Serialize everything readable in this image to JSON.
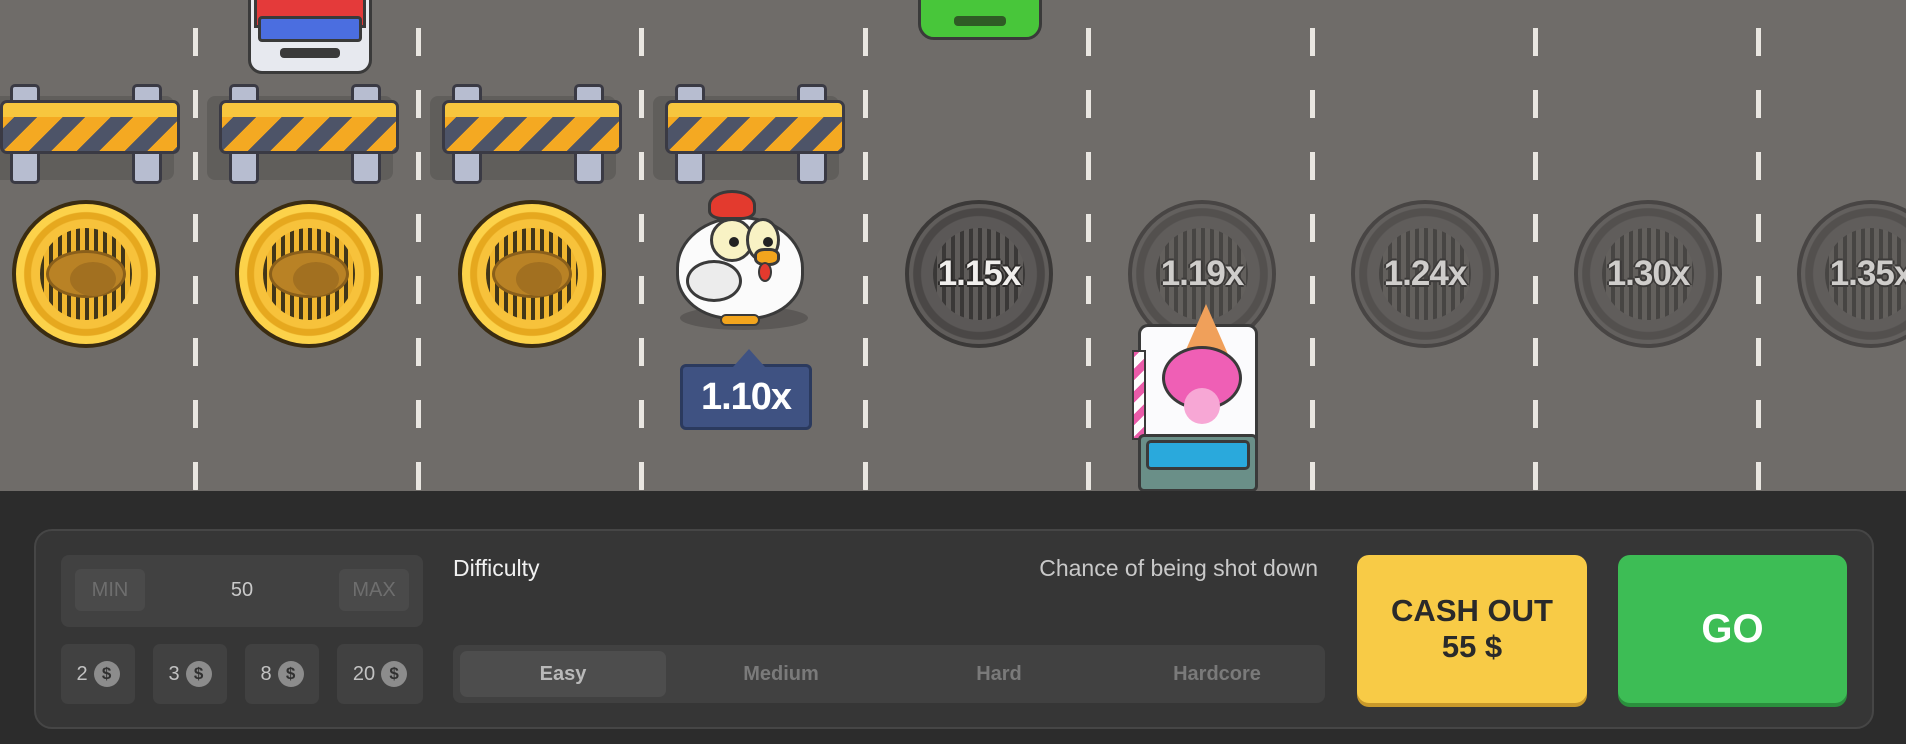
{
  "road": {
    "multipliers": [
      "1.15x",
      "1.19x",
      "1.24x",
      "1.30x",
      "1.35x"
    ],
    "current_multiplier": "1.10x",
    "collected_coins": 3
  },
  "bet": {
    "min_label": "MIN",
    "value": "50",
    "max_label": "MAX",
    "chips": [
      {
        "amount": "2",
        "symbol": "$"
      },
      {
        "amount": "3",
        "symbol": "$"
      },
      {
        "amount": "8",
        "symbol": "$"
      },
      {
        "amount": "20",
        "symbol": "$"
      }
    ]
  },
  "difficulty": {
    "label": "Difficulty",
    "chance_label": "Chance of being shot down",
    "options": [
      "Easy",
      "Medium",
      "Hard",
      "Hardcore"
    ],
    "selected": "Easy"
  },
  "actions": {
    "cashout_label": "CASH OUT",
    "cashout_amount": "55 $",
    "go_label": "GO"
  },
  "colors": {
    "cashout": "#f8cb46",
    "go": "#3dbd55",
    "multiplier_badge": "#3f5282"
  }
}
